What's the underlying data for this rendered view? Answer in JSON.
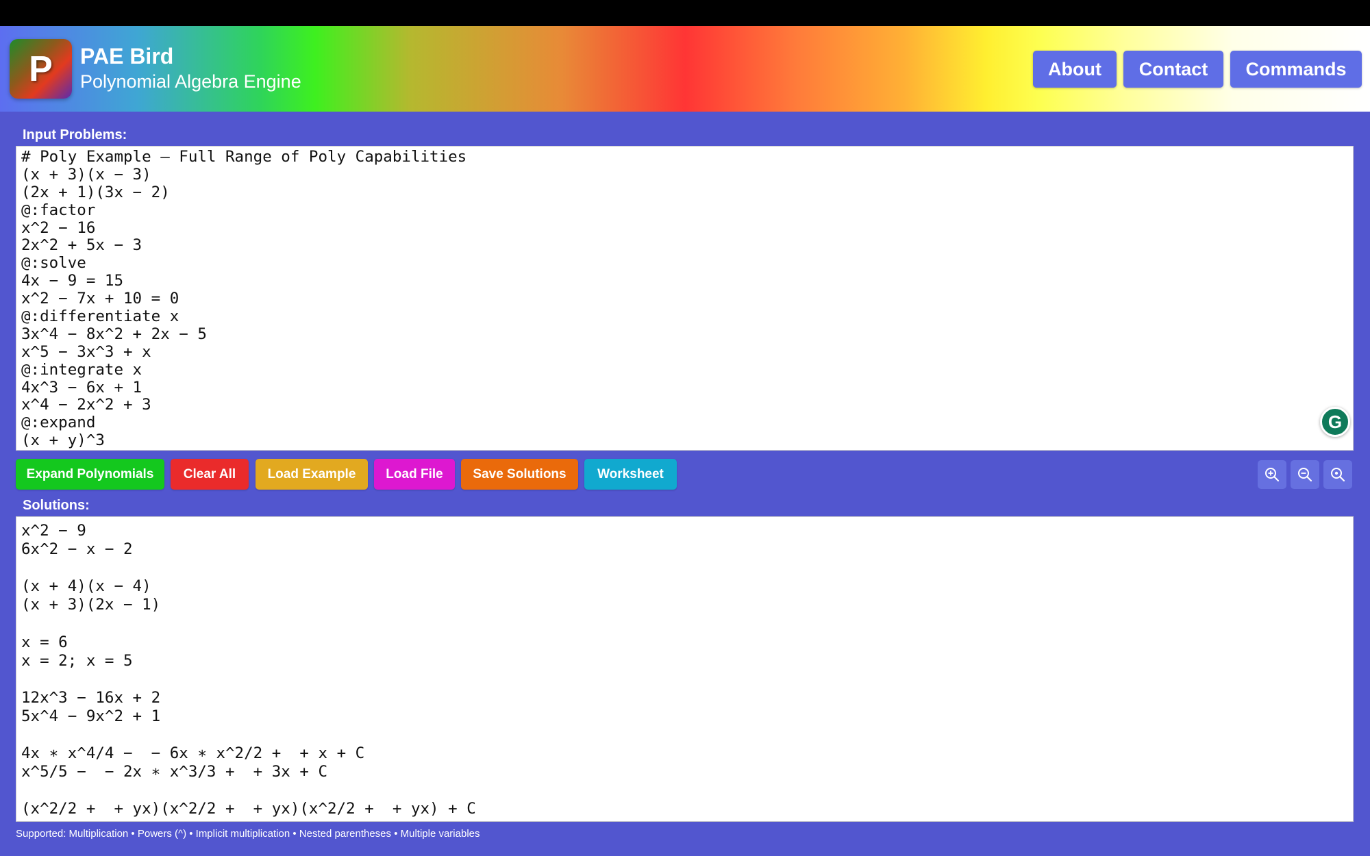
{
  "app": {
    "logo_letter": "P",
    "title": "PAE Bird",
    "subtitle": "Polynomial Algebra Engine"
  },
  "nav": {
    "about": "About",
    "contact": "Contact",
    "commands": "Commands"
  },
  "input": {
    "label": "Input Problems:",
    "lines": [
      "# Poly Example — Full Range of Poly Capabilities",
      "(x + 3)(x − 3)",
      "(2x + 1)(3x − 2)",
      "@:factor",
      "x^2 − 16",
      "2x^2 + 5x − 3",
      "@:solve",
      "4x − 9 = 15",
      "x^2 − 7x + 10 = 0",
      "@:differentiate x",
      "3x^4 − 8x^2 + 2x − 5",
      "x^5 − 3x^3 + x",
      "@:integrate x",
      "4x^3 − 6x + 1",
      "x^4 − 2x^2 + 3",
      "@:expand",
      "(x + y)^3"
    ]
  },
  "grammar_badge": "G",
  "toolbar": {
    "expand": "Expand Polynomials",
    "clear": "Clear All",
    "load_example": "Load Example",
    "load_file": "Load File",
    "save": "Save Solutions",
    "worksheet": "Worksheet",
    "icons": [
      "zoom-in-icon",
      "zoom-out-icon",
      "zoom-reset-icon"
    ]
  },
  "solutions": {
    "label": "Solutions:",
    "lines": [
      "x^2 − 9",
      "6x^2 − x − 2",
      "",
      "(x + 4)(x − 4)",
      "(x + 3)(2x − 1)",
      "",
      "x = 6",
      "x = 2; x = 5",
      "",
      "12x^3 − 16x + 2",
      "5x^4 − 9x^2 + 1",
      "",
      "4x ∗ x^4/4 −  − 6x ∗ x^2/2 +  + x + C",
      "x^5/5 −  − 2x ∗ x^3/3 +  + 3x + C",
      "",
      "(x^2/2 +  + yx)(x^2/2 +  + yx)(x^2/2 +  + yx) + C"
    ]
  },
  "footer": "Supported: Multiplication • Powers (^) • Implicit multiplication • Nested parentheses • Multiple variables",
  "colors": {
    "background": "#5256cf",
    "nav_button": "#5f6ee6",
    "expand": "#14c81e",
    "clear": "#ea2b2b",
    "load_example": "#e2a920",
    "load_file": "#dd18d0",
    "save": "#ea6a0b",
    "worksheet": "#11a9cf"
  }
}
